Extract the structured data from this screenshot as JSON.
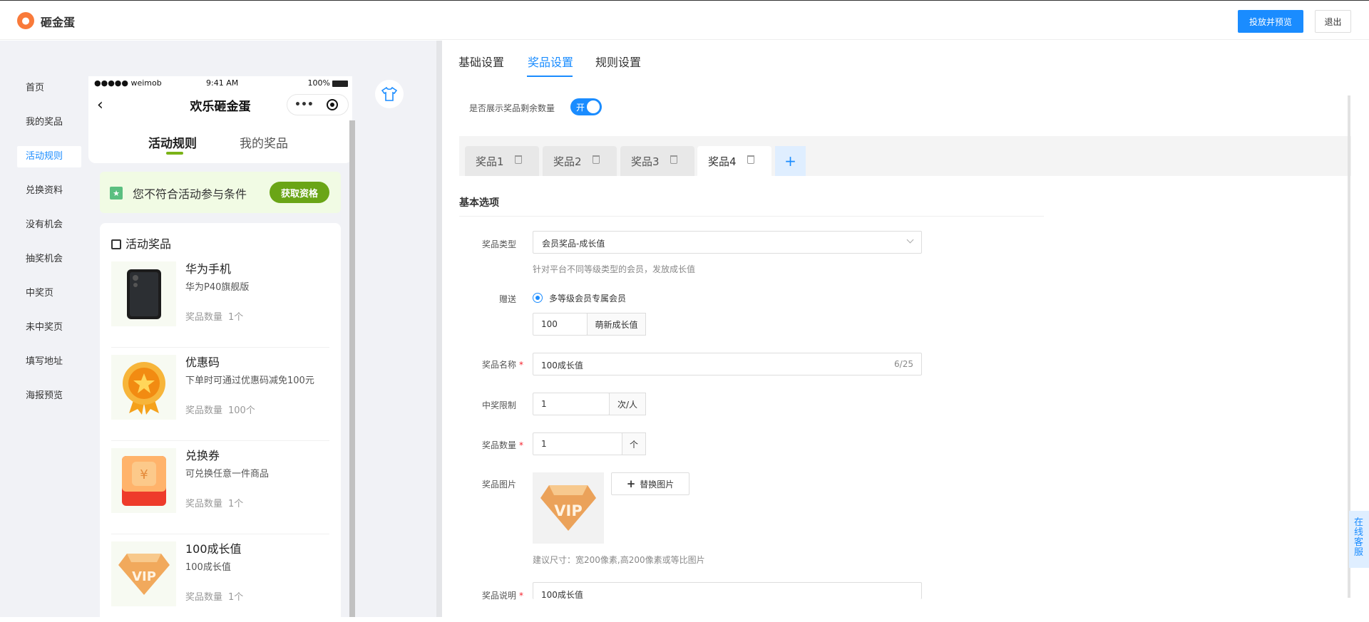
{
  "topbar": {
    "app_name": "砸金蛋",
    "publish_label": "投放并预览",
    "logout_label": "退出",
    "accent": "#1a8cff"
  },
  "sidenav": {
    "items": [
      {
        "label": "首页"
      },
      {
        "label": "我的奖品"
      },
      {
        "label": "活动规则"
      },
      {
        "label": "兑换资料"
      },
      {
        "label": "没有机会"
      },
      {
        "label": "抽奖机会"
      },
      {
        "label": "中奖页"
      },
      {
        "label": "未中奖页"
      },
      {
        "label": "填写地址"
      },
      {
        "label": "海报预览"
      }
    ],
    "active": "活动规则"
  },
  "preview": {
    "status_left": "●●●●● weimob",
    "status_time": "9:41 AM",
    "status_battery": "100%",
    "title": "欢乐砸金蛋",
    "tab_rule": "活动规则",
    "tab_prize": "我的奖品",
    "notice_text": "您不符合活动参与条件",
    "notice_button": "获取资格",
    "card_title": "活动奖品",
    "qty_label": "奖品数量",
    "prizes": [
      {
        "name": "华为手机",
        "desc": "华为P40旗舰版",
        "qty": "1个",
        "icon": "phone-icon"
      },
      {
        "name": "优惠码",
        "desc": "下单时可通过优惠码减免100元",
        "qty": "100个",
        "icon": "medal-icon"
      },
      {
        "name": "兑换券",
        "desc": "可兑换任意一件商品",
        "qty": "1个",
        "icon": "red-envelope-icon"
      },
      {
        "name": "100成长值",
        "desc": "100成长值",
        "qty": "1个",
        "icon": "vip-diamond-icon"
      }
    ]
  },
  "main": {
    "tabs": [
      {
        "label": "基础设置"
      },
      {
        "label": "奖品设置"
      },
      {
        "label": "规则设置"
      }
    ],
    "active_tab": "奖品设置",
    "show_remaining_label": "是否展示奖品剩余数量",
    "toggle_text": "开",
    "prize_tabs": [
      {
        "label": "奖品1"
      },
      {
        "label": "奖品2"
      },
      {
        "label": "奖品3"
      },
      {
        "label": "奖品4"
      }
    ],
    "active_prize_tab": "奖品4",
    "add_tab_label": "+",
    "section_title": "基本选项",
    "form": {
      "type_label": "奖品类型",
      "type_value": "会员奖品-成长值",
      "type_hint": "针对平台不同等级类型的会员，发放成长值",
      "gift_label": "赠送",
      "gift_option": "多等级会员专属会员",
      "growth_value": "100",
      "growth_addon": "萌新成长值",
      "name_label": "奖品名称",
      "name_value": "100成长值",
      "name_counter": "6/25",
      "limit_label": "中奖限制",
      "limit_value": "1",
      "limit_addon": "次/人",
      "qty_label": "奖品数量",
      "qty_value": "1",
      "qty_addon": "个",
      "image_label": "奖品图片",
      "replace_label": "替换图片",
      "image_hint": "建议尺寸：宽200像素,高200像素或等比图片",
      "desc_label": "奖品说明",
      "desc_value": "100成长值",
      "required_mark": "*"
    }
  },
  "service_label": "在线客服"
}
